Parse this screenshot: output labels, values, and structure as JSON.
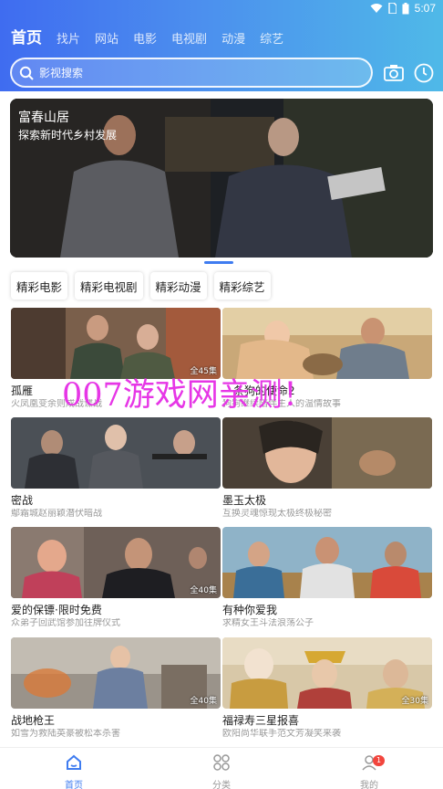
{
  "status": {
    "time": "5:07"
  },
  "tabs": [
    {
      "label": "首页",
      "active": true
    },
    {
      "label": "找片"
    },
    {
      "label": "网站"
    },
    {
      "label": "电影"
    },
    {
      "label": "电视剧"
    },
    {
      "label": "动漫"
    },
    {
      "label": "综艺"
    }
  ],
  "search": {
    "placeholder": "影视搜索"
  },
  "banner": {
    "title": "富春山居",
    "subtitle": "探索新时代乡村发展"
  },
  "categories": [
    "精彩电影",
    "精彩电视剧",
    "精彩动漫",
    "精彩综艺"
  ],
  "cards": [
    {
      "title": "孤雁",
      "desc": "火凤凰变余则成战谍战",
      "badge": "全45集"
    },
    {
      "title": "一条狗的使命2",
      "desc": "狗狗继续陪伴主人的温情故事",
      "badge": ""
    },
    {
      "title": "密战",
      "desc": "鄢霜城赵丽颖潜伏暗战",
      "badge": ""
    },
    {
      "title": "墨玉太极",
      "desc": "互换灵魂惊现太极终极秘密",
      "badge": ""
    },
    {
      "title": "爱的保镖·限时免费",
      "desc": "众弟子回武馆参加往牌仪式",
      "badge": "全40集"
    },
    {
      "title": "有种你爱我",
      "desc": "求精女王斗法浪荡公子",
      "badge": ""
    },
    {
      "title": "战地枪王",
      "desc": "如雪为救陆英豪被松本杀害",
      "badge": "全40集"
    },
    {
      "title": "福禄寿三星报喜",
      "desc": "欧阳尚华联手范文芳凝笑来袭",
      "badge": "全30集"
    }
  ],
  "watermark": "007游戏网亲测！",
  "bottom_nav": [
    {
      "label": "首页",
      "icon": "home-icon",
      "active": true
    },
    {
      "label": "分类",
      "icon": "grid-icon"
    },
    {
      "label": "我的",
      "icon": "user-icon",
      "badge": "1"
    }
  ],
  "colors": {
    "accent": "#3f7cf0",
    "header_start": "#3f6cf0",
    "header_end": "#4fb9e8",
    "watermark": "#e636e6"
  }
}
